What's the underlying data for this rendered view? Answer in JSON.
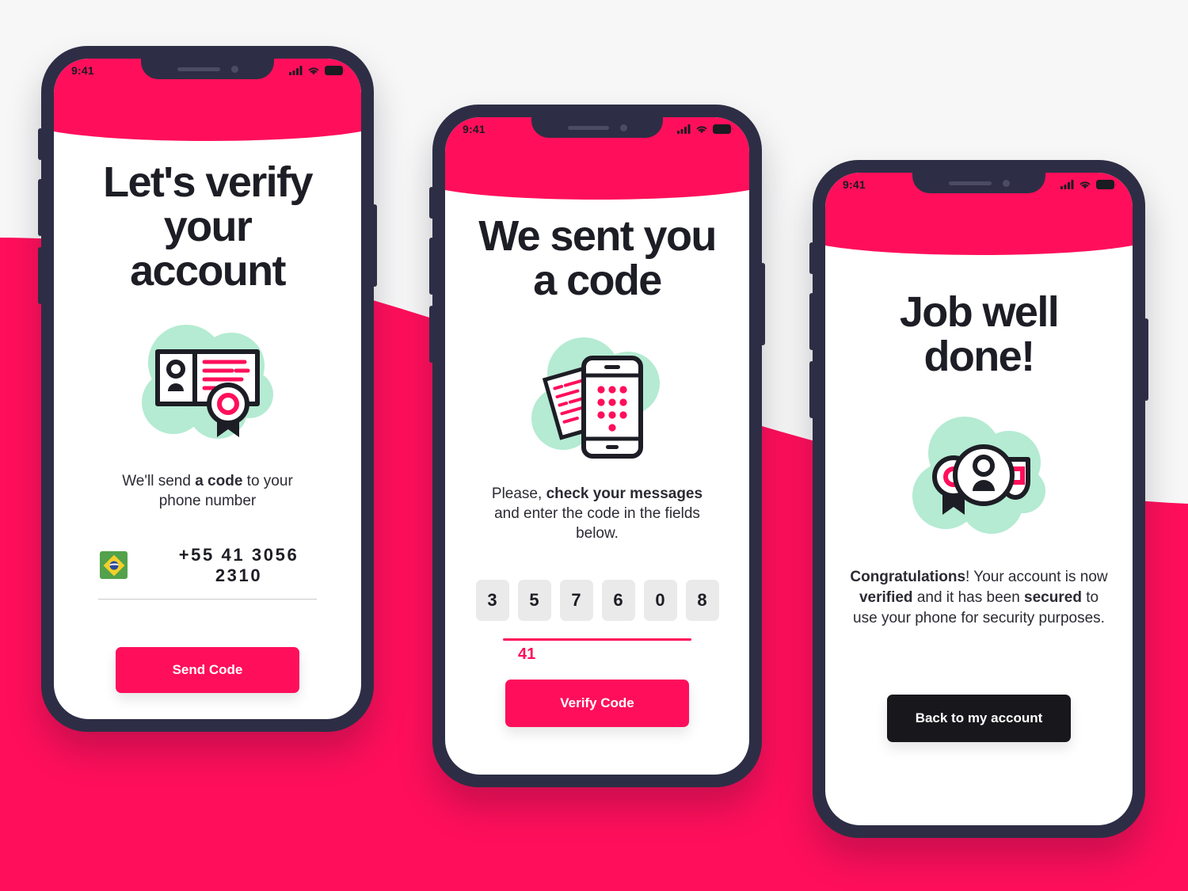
{
  "theme": {
    "pink": "#ff0f5b",
    "navy": "#2d2e45",
    "mint": "#b4ebd2",
    "dark": "#18181c",
    "page_bg": "#f7f7f7"
  },
  "status_bar": {
    "time": "9:41",
    "signal_icon": "cellular-signal-icon",
    "wifi_icon": "wifi-icon",
    "battery_icon": "battery-icon"
  },
  "screens": [
    {
      "id": "verify-account",
      "title": "Let's verify your account",
      "illustration": "id-card-badge-icon",
      "subtitle_parts": [
        {
          "text": "We'll send ",
          "bold": false
        },
        {
          "text": "a code",
          "bold": true
        },
        {
          "text": " to your phone number",
          "bold": false
        }
      ],
      "phone_field": {
        "flag": "brazil-flag-icon",
        "value": "+55 41 3056 2310"
      },
      "cta": {
        "label": "Send Code",
        "style": "pink"
      }
    },
    {
      "id": "enter-code",
      "title": "We sent you a code",
      "illustration": "sms-phone-icon",
      "subtitle_parts": [
        {
          "text": "Please, ",
          "bold": false
        },
        {
          "text": "check your messages",
          "bold": true
        },
        {
          "text": " and enter the code in the fields below.",
          "bold": false
        }
      ],
      "code_digits": [
        "3",
        "5",
        "7",
        "6",
        "0",
        "8"
      ],
      "timer": "41",
      "cta": {
        "label": "Verify Code",
        "style": "pink"
      }
    },
    {
      "id": "success",
      "title": "Job well done!",
      "illustration": "verified-profile-badge-icon",
      "subtitle_parts": [
        {
          "text": "Congratulations",
          "bold": true
        },
        {
          "text": "! Your account is now ",
          "bold": false
        },
        {
          "text": "verified",
          "bold": true
        },
        {
          "text": " and it has been ",
          "bold": false
        },
        {
          "text": "secured",
          "bold": true
        },
        {
          "text": " to use your phone for security purposes.",
          "bold": false
        }
      ],
      "cta": {
        "label": "Back to my account",
        "style": "dark"
      }
    }
  ]
}
